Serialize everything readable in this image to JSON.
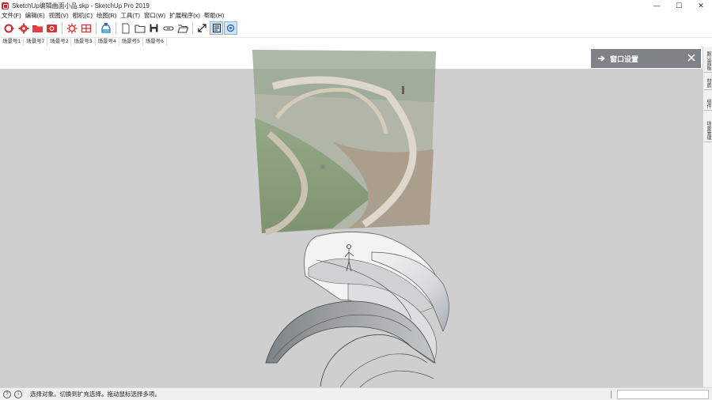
{
  "window": {
    "title": "SketchUp编辑曲面小品.skp - SketchUp Pro 2019",
    "minimize": "—",
    "maximize": "☐",
    "close": "✕"
  },
  "menu": [
    "文件(F)",
    "编辑(E)",
    "视图(V)",
    "相机(C)",
    "绘图(R)",
    "工具(T)",
    "窗口(W)",
    "扩展程序(x)",
    "帮助(H)"
  ],
  "toolbar_icons": [
    "loop-icon",
    "gear-icon",
    "folder-red-icon",
    "camera-red-icon",
    "sun-gear-icon",
    "grid-icon",
    "bottle-icon",
    "page-icon",
    "folder-icon",
    "save-icon",
    "link-icon",
    "open-icon",
    "expand-icon",
    "tray-icon",
    "settings-icon"
  ],
  "scenes": [
    "场景号1",
    "场景号7",
    "场景号2",
    "场景号3",
    "场景号4",
    "场景号5",
    "场景号6"
  ],
  "tray": {
    "title": "窗口设置"
  },
  "dock_tabs": [
    "默认面板",
    "材质",
    "组件",
    "场景管理"
  ],
  "status": {
    "help_icon": "?",
    "info_icon": "i",
    "message": "选择对象。切换到扩充选择。拖动鼠标选择多项。",
    "measurements_value": ""
  },
  "colors": {
    "toolbar_active": "#cfe3f5",
    "tray_header": "#7f8388",
    "ground": "#cfcfcf"
  }
}
